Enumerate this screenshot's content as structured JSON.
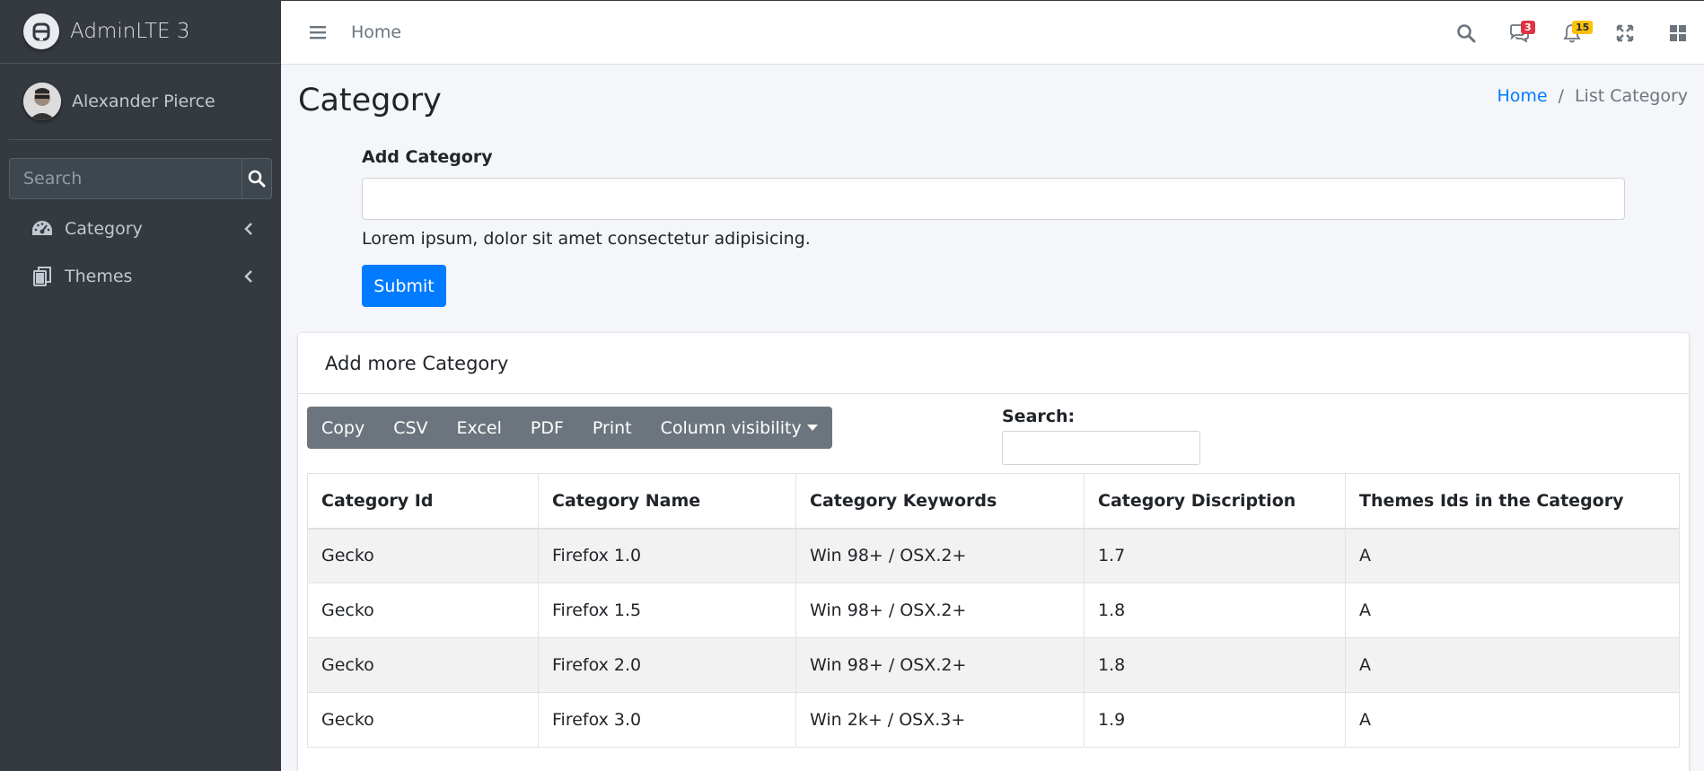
{
  "sidebar": {
    "brand": "AdminLTE 3",
    "user_name": "Alexander Pierce",
    "search_placeholder": "Search",
    "items": [
      {
        "label": "Category",
        "icon": "tachometer-icon"
      },
      {
        "label": "Themes",
        "icon": "copy-icon"
      }
    ]
  },
  "navbar": {
    "home": "Home",
    "messages_count": "3",
    "notifications_count": "15"
  },
  "page": {
    "title": "Category",
    "breadcrumb": {
      "home": "Home",
      "separator": "/",
      "current": "List Category"
    }
  },
  "form": {
    "label": "Add Category",
    "input_value": "",
    "help_text": "Lorem ipsum, dolor sit amet consectetur adipisicing.",
    "submit": "Submit"
  },
  "card": {
    "title": "Add more Category",
    "buttons": [
      "Copy",
      "CSV",
      "Excel",
      "PDF",
      "Print",
      "Column visibility"
    ],
    "search_label": "Search:",
    "search_value": "",
    "columns": [
      "Category Id",
      "Category Name",
      "Category Keywords",
      "Category Discription",
      "Themes Ids in the Category"
    ],
    "rows": [
      [
        "Gecko",
        "Firefox 1.0",
        "Win 98+ / OSX.2+",
        "1.7",
        "A"
      ],
      [
        "Gecko",
        "Firefox 1.5",
        "Win 98+ / OSX.2+",
        "1.8",
        "A"
      ],
      [
        "Gecko",
        "Firefox 2.0",
        "Win 98+ / OSX.2+",
        "1.8",
        "A"
      ],
      [
        "Gecko",
        "Firefox 3.0",
        "Win 2k+ / OSX.3+",
        "1.9",
        "A"
      ]
    ]
  },
  "colors": {
    "sidebar_bg": "#343a40",
    "primary": "#007bff",
    "secondary": "#6c757d",
    "badge_danger": "#dc3545",
    "badge_warning": "#ffc107"
  }
}
